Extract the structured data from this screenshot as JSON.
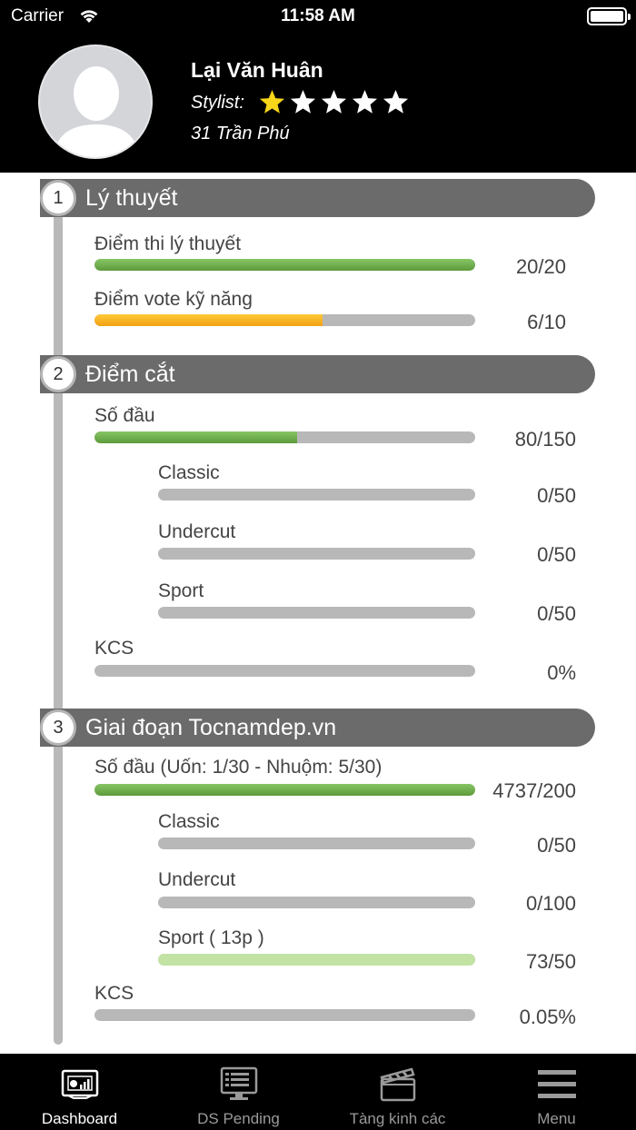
{
  "status_bar": {
    "carrier": "Carrier",
    "time": "11:58 AM"
  },
  "profile": {
    "name": "Lại Văn Huân",
    "stylist_label": "Stylist:",
    "rating": 1,
    "rating_max": 5,
    "address": "31 Trần Phú",
    "colors": {
      "star_on": "#f7d51b",
      "star_off": "#ffffff"
    }
  },
  "sections": [
    {
      "number": "1",
      "title": "Lý thuyết"
    },
    {
      "number": "2",
      "title": "Điểm cắt"
    },
    {
      "number": "3",
      "title": "Giai đoạn Tocnamdep.vn"
    }
  ],
  "rows": [
    {
      "label": "Điểm thi lý thuyết",
      "value": "20/20",
      "progress": 1.0,
      "color": "green"
    },
    {
      "label": "Điểm vote kỹ năng",
      "value": "6/10",
      "progress": 0.6,
      "color": "orange"
    },
    {
      "label": "Số đầu",
      "value": "80/150",
      "progress": 0.533,
      "color": "green"
    },
    {
      "label": "Classic",
      "value": "0/50",
      "progress": 0,
      "color": "green"
    },
    {
      "label": "Undercut",
      "value": "0/50",
      "progress": 0,
      "color": "green"
    },
    {
      "label": "Sport",
      "value": "0/50",
      "progress": 0,
      "color": "green"
    },
    {
      "label": "KCS",
      "value": "0%",
      "progress": 0,
      "color": "green"
    },
    {
      "label": "Số đầu (Uốn: 1/30 - Nhuộm: 5/30)",
      "value": "4737/200",
      "progress": 1.0,
      "color": "green"
    },
    {
      "label": "Classic",
      "value": "0/50",
      "progress": 0,
      "color": "green"
    },
    {
      "label": "Undercut",
      "value": "0/100",
      "progress": 0,
      "color": "green"
    },
    {
      "label": "Sport ( 13p )",
      "value": "73/50",
      "progress": 1.0,
      "color": "lightgreen"
    },
    {
      "label": "KCS",
      "value": "0.05%",
      "progress": 0.0005,
      "color": "green"
    }
  ],
  "tab_bar": {
    "tabs": [
      {
        "label": "Dashboard",
        "icon": "dashboard-icon",
        "active": true
      },
      {
        "label": "DS Pending",
        "icon": "monitor-list-icon",
        "active": false
      },
      {
        "label": "Tàng kinh các",
        "icon": "clapperboard-icon",
        "active": false
      },
      {
        "label": "Menu",
        "icon": "hamburger-menu-icon",
        "active": false
      }
    ]
  }
}
